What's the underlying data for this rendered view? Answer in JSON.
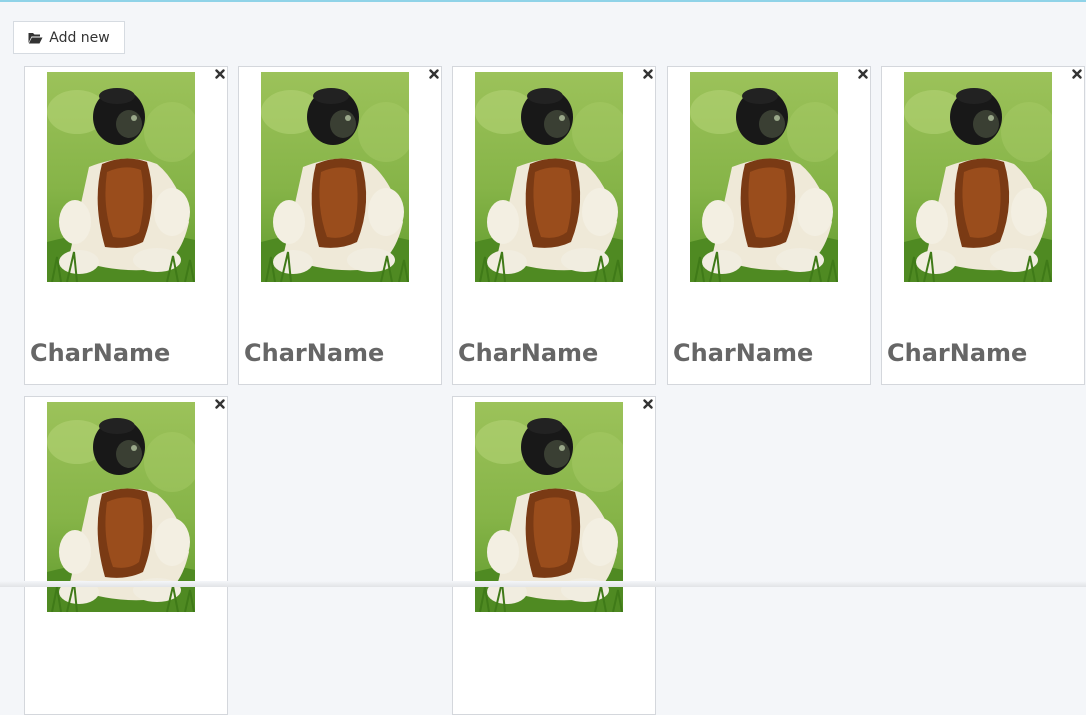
{
  "toolbar": {
    "add_label": "Add new",
    "add_icon": "folder-open-icon"
  },
  "cards": [
    {
      "name": "CharName",
      "image": "lemur-photo",
      "close_icon": "close-icon"
    },
    {
      "name": "CharName",
      "image": "lemur-photo",
      "close_icon": "close-icon"
    },
    {
      "name": "CharName",
      "image": "lemur-photo",
      "close_icon": "close-icon"
    },
    {
      "name": "CharName",
      "image": "lemur-photo",
      "close_icon": "close-icon"
    },
    {
      "name": "CharName",
      "image": "lemur-photo",
      "close_icon": "close-icon"
    },
    {
      "name": "",
      "image": "lemur-photo",
      "close_icon": "close-icon"
    },
    {
      "name": "",
      "image": "lemur-photo",
      "close_icon": "close-icon"
    }
  ],
  "colors": {
    "accent": "#8fd3e8",
    "page_bg": "#f4f6f9",
    "card_border": "#d4d7dc",
    "name_text": "#666666"
  }
}
